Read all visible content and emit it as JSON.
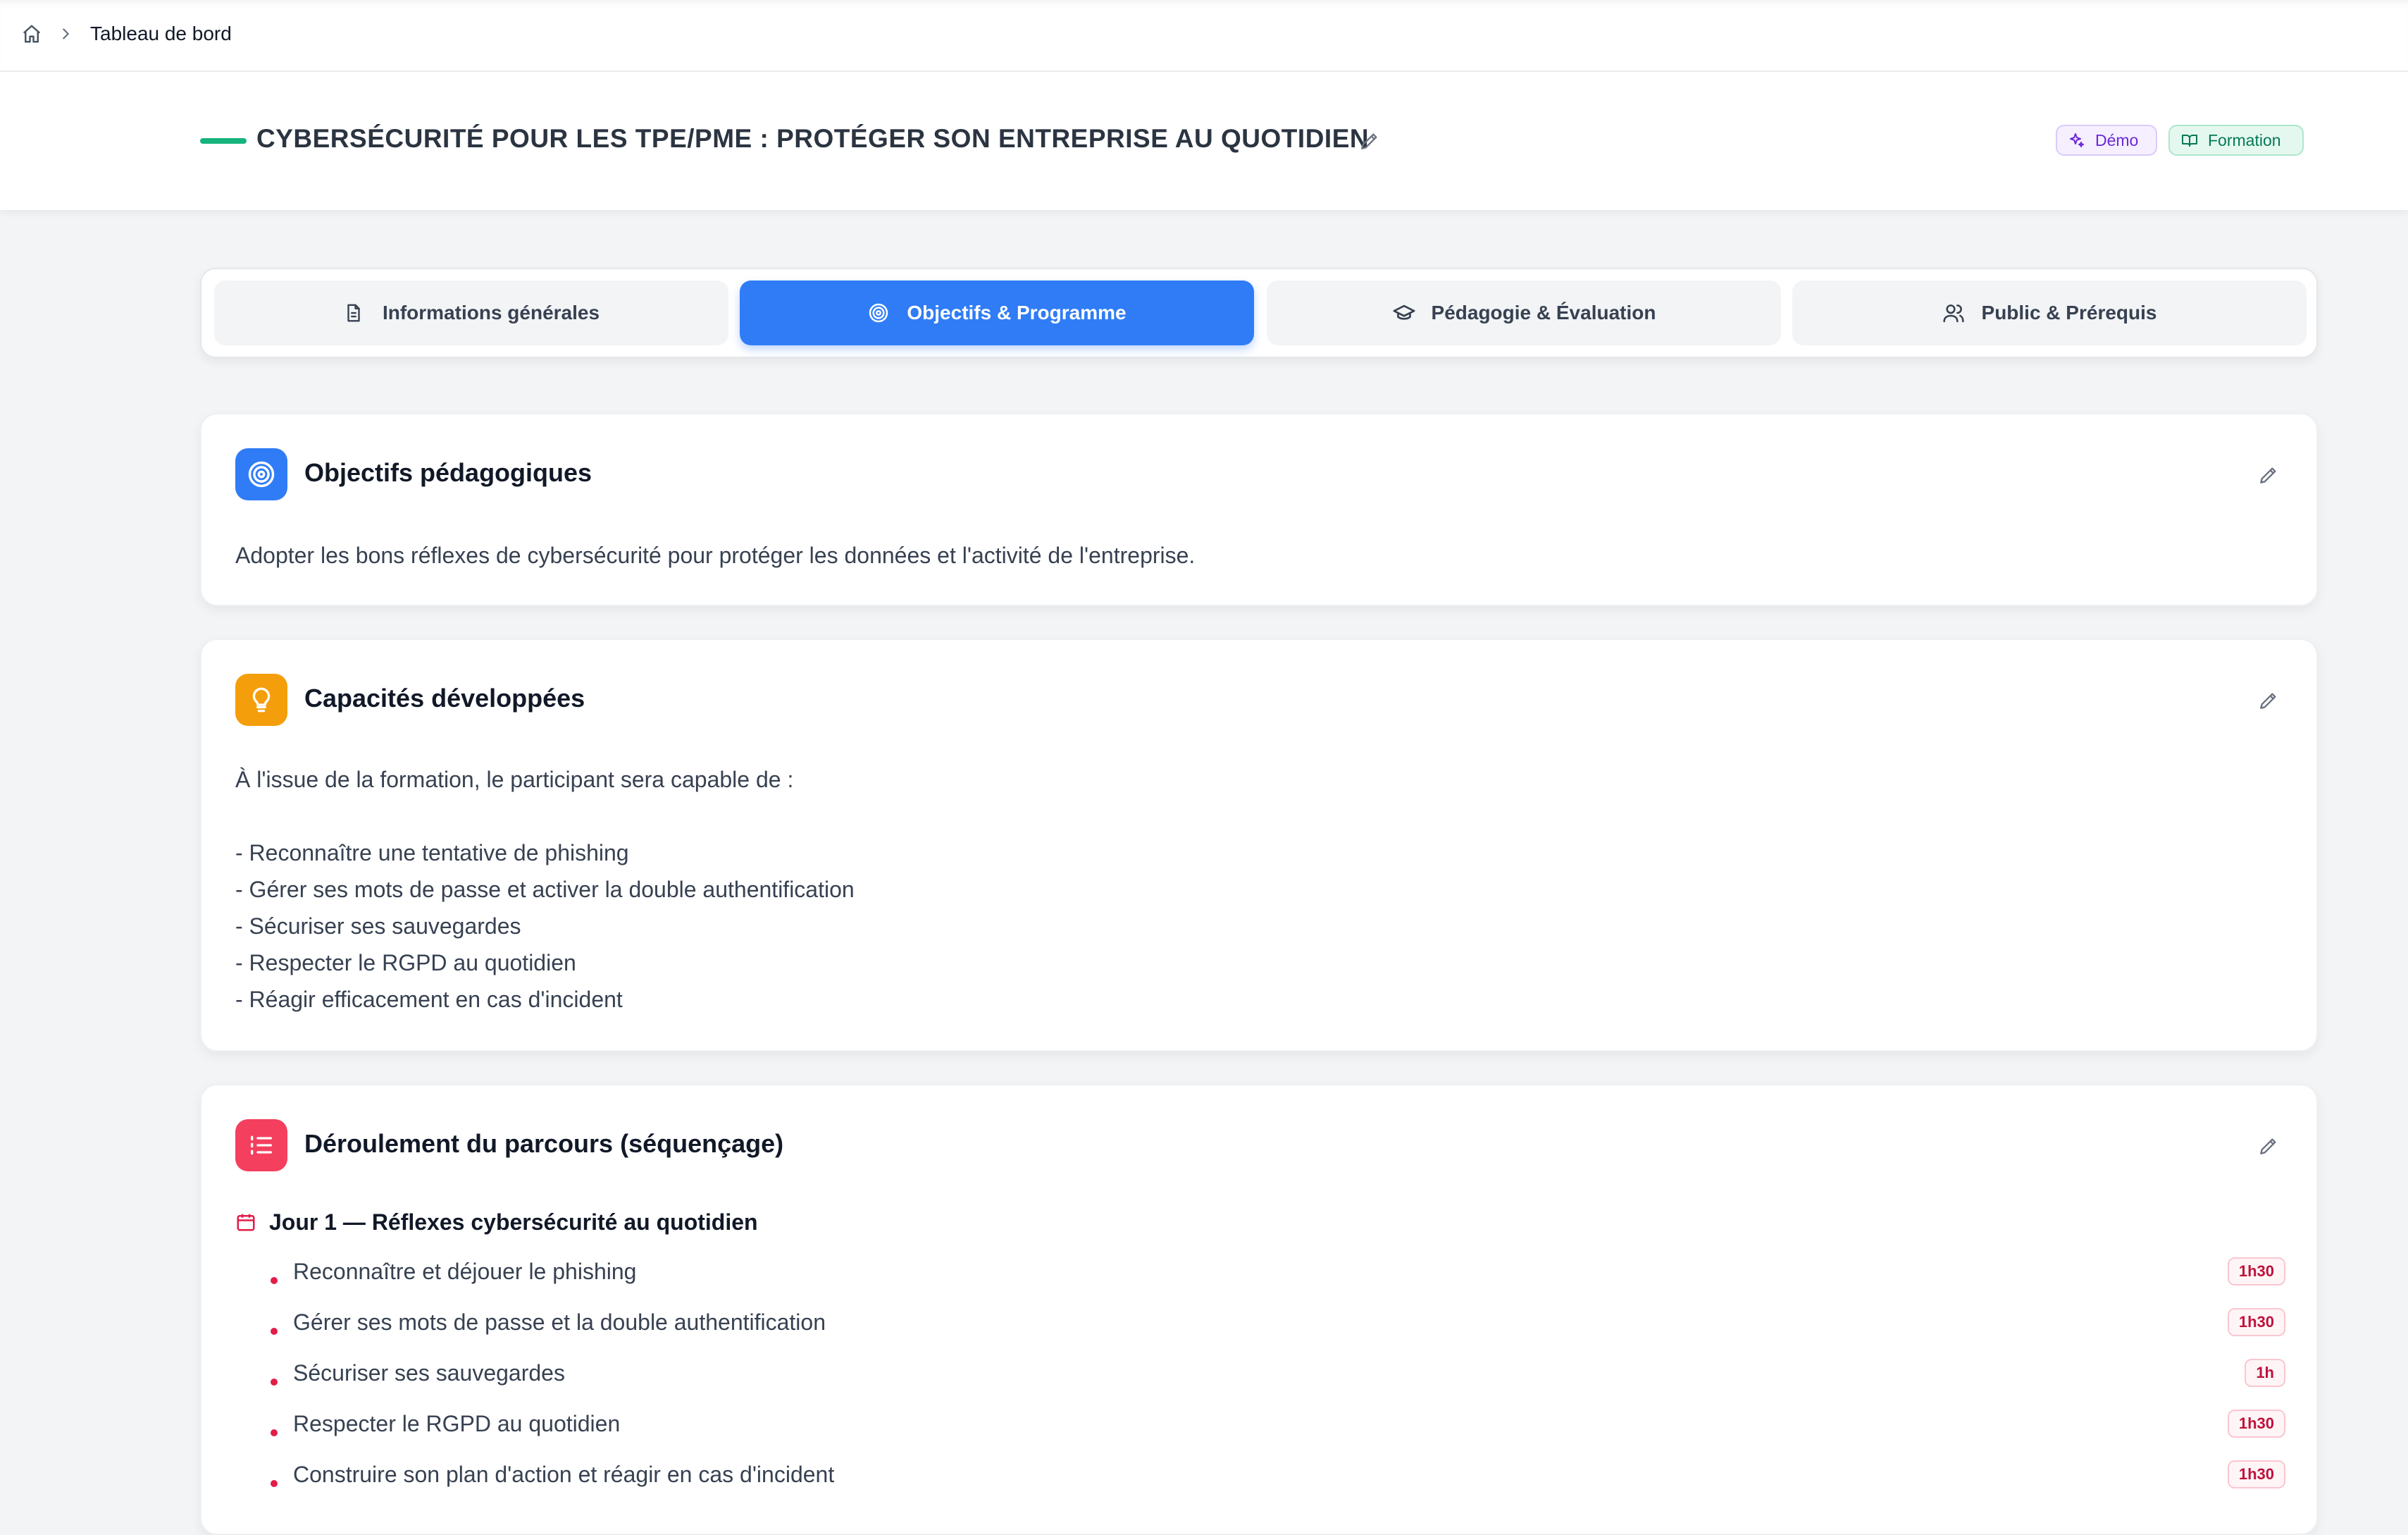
{
  "breadcrumb": {
    "label": "Tableau de bord"
  },
  "header": {
    "title": "CYBERSÉCURITÉ POUR LES TPE/PME : PROTÉGER SON ENTREPRISE AU QUOTIDIEN",
    "badges": {
      "demo": "Démo",
      "formation": "Formation"
    }
  },
  "tabs": [
    {
      "label": "Informations générales",
      "icon": "file-icon"
    },
    {
      "label": "Objectifs & Programme",
      "icon": "target-icon",
      "active": true
    },
    {
      "label": "Pédagogie & Évaluation",
      "icon": "graduation-cap-icon"
    },
    {
      "label": "Public & Prérequis",
      "icon": "users-icon"
    }
  ],
  "objectifs": {
    "title": "Objectifs pédagogiques",
    "text": "Adopter les bons réflexes de cybersécurité pour protéger les données et l'activité de l'entreprise."
  },
  "capacites": {
    "title": "Capacités développées",
    "intro": "À l'issue de la formation, le participant sera capable de :",
    "items": [
      "- Reconnaître une tentative de phishing",
      "- Gérer ses mots de passe et activer la double authentification",
      "- Sécuriser ses sauvegardes",
      "- Respecter le RGPD au quotidien",
      "- Réagir efficacement en cas d'incident"
    ]
  },
  "deroulement": {
    "title": "Déroulement du parcours (séquençage)",
    "day1": {
      "label": "Jour 1 — Réflexes cybersécurité au quotidien",
      "items": [
        {
          "text": "Reconnaître et déjouer le phishing",
          "duration": "1h30"
        },
        {
          "text": "Gérer ses mots de passe et la double authentification",
          "duration": "1h30"
        },
        {
          "text": "Sécuriser ses sauvegardes",
          "duration": "1h"
        },
        {
          "text": "Respecter le RGPD au quotidien",
          "duration": "1h30"
        },
        {
          "text": "Construire son plan d'action et réagir en cas d'incident",
          "duration": "1h30"
        }
      ]
    }
  },
  "colors": {
    "accent": "#2f7cf6",
    "bar_green": "#16b47c",
    "capacites_icon": "#f59e0b",
    "deroulement_icon": "#f43f5e"
  }
}
